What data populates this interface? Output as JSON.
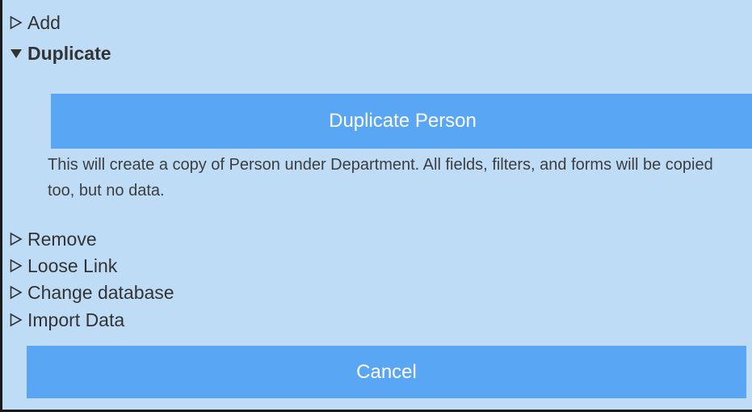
{
  "sections": {
    "add": "Add",
    "duplicate": "Duplicate",
    "remove": "Remove",
    "loose_link": "Loose Link",
    "change_database": "Change database",
    "import_data": "Import Data"
  },
  "duplicate_panel": {
    "button_label": "Duplicate Person",
    "description": "This will create a copy of Person under Department. All fields, filters, and forms will be copied too, but no data."
  },
  "cancel_label": "Cancel",
  "colors": {
    "background": "#bfdcf7",
    "button": "#58a6f4",
    "button_text": "#ffffff"
  }
}
